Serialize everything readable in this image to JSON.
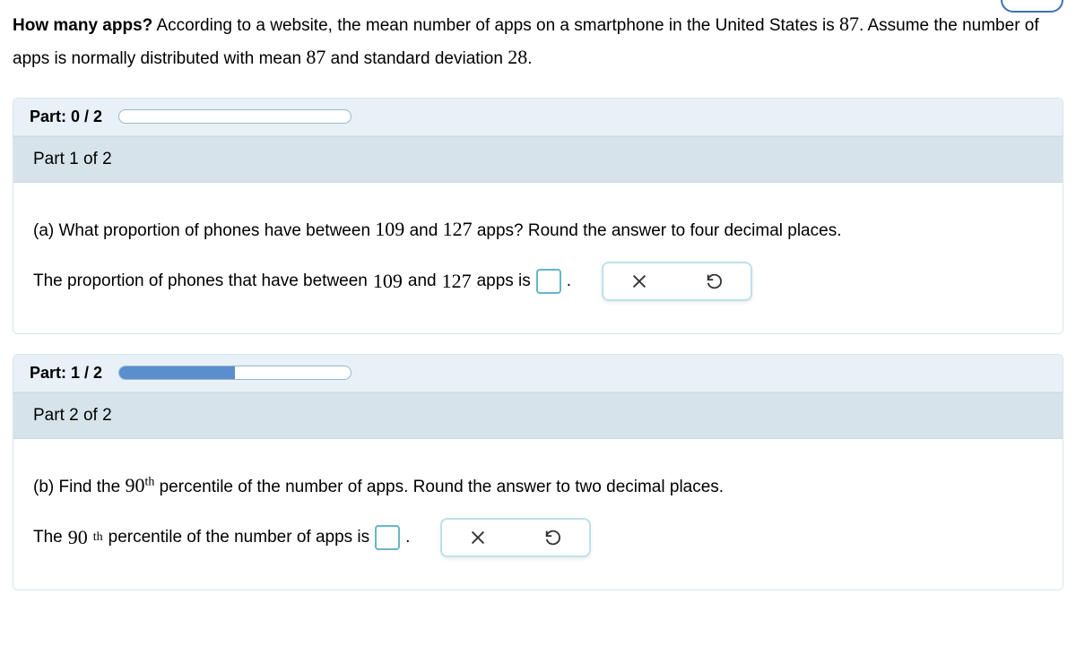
{
  "stem": {
    "bold_lead": "How many apps?",
    "text1": " According to a website, the mean number of apps on a smartphone in the United States is ",
    "mean1": "87",
    "text2": ". Assume the number of apps is normally distributed with mean ",
    "mean2": "87",
    "text3": " and standard deviation ",
    "sd": "28",
    "text4": "."
  },
  "progress1": {
    "label": "Part: 0 / 2",
    "percent": 0
  },
  "part1": {
    "header": "Part 1 of 2",
    "q_pre": "(a) What proportion of phones have between ",
    "v1": "109",
    "q_mid": " and ",
    "v2": "127",
    "q_post": " apps? Round the answer to four decimal places.",
    "ans_pre": "The proportion of phones that have between ",
    "ans_v1": "109",
    "ans_mid": " and ",
    "ans_v2": "127",
    "ans_post": " apps is ",
    "period": "."
  },
  "progress2": {
    "label": "Part: 1 / 2",
    "percent": 50
  },
  "part2": {
    "header": "Part 2 of 2",
    "q_pre": "(b) Find the ",
    "q_base": "90",
    "q_sup": "th",
    "q_post": " percentile of the number of apps. Round the answer to two decimal places.",
    "ans_pre": "The ",
    "ans_base": "90",
    "ans_sup": "th",
    "ans_post": " percentile of the number of apps is ",
    "period": "."
  }
}
